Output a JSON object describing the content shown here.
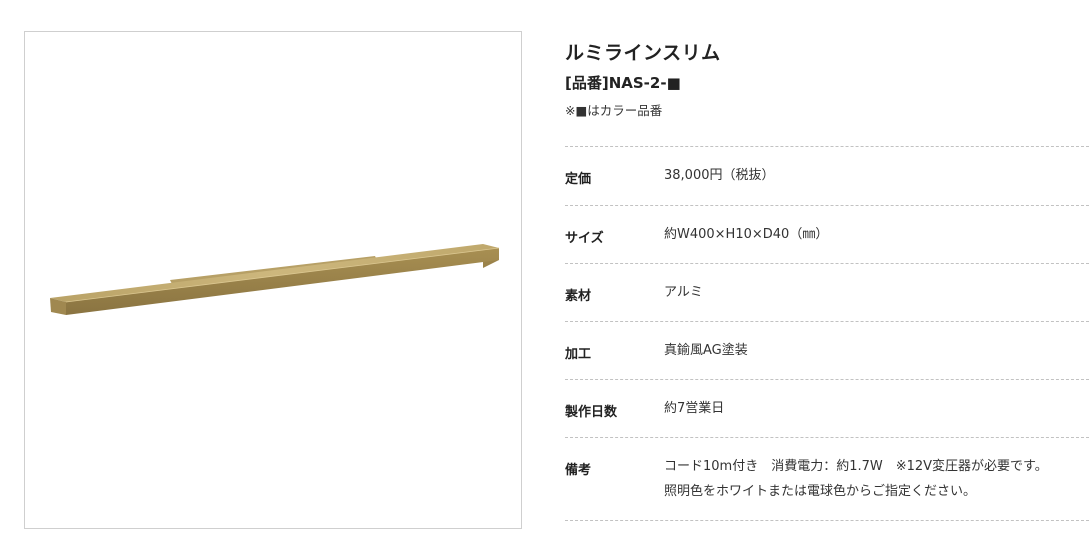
{
  "product": {
    "image_alt": "ルミラインスリム",
    "title": "ルミラインスリム",
    "part_number": "[品番]NAS-2-■",
    "color_note": "※■はカラー品番"
  },
  "specs": [
    {
      "label": "定価",
      "value": "38,000円（税抜）"
    },
    {
      "label": "サイズ",
      "value": "約W400×H10×D40（㎜）"
    },
    {
      "label": "素材",
      "value": "アルミ"
    },
    {
      "label": "加工",
      "value": "真鍮風AG塗装"
    },
    {
      "label": "製作日数",
      "value": "約7営業日"
    },
    {
      "label": "備考",
      "value": "コード10m付き　消費電力：約1.7W　※12V変圧器が必要です。",
      "value2": "照明色をホワイトまたは電球色からご指定ください。"
    }
  ],
  "colors": {
    "brass_light": "#c9b37a",
    "brass_mid": "#b39a5c",
    "brass_dark": "#8e7844",
    "divider": "#c2c2c2"
  }
}
